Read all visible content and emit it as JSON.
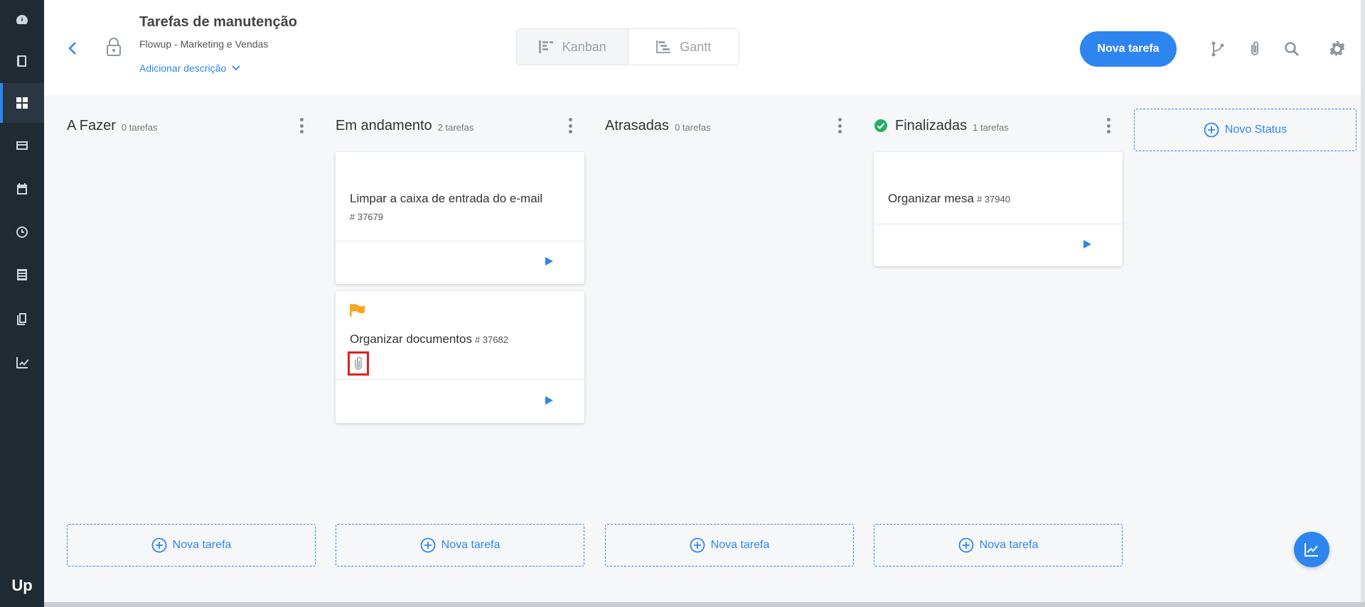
{
  "header": {
    "title": "Tarefas de manutenção",
    "subtitle": "Flowup - Marketing e Vendas",
    "add_description": "Adicionar descrição",
    "views": [
      {
        "label": "Kanban",
        "active": true
      },
      {
        "label": "Gantt",
        "active": false
      }
    ],
    "new_task_label": "Nova tarefa"
  },
  "board": {
    "columns": [
      {
        "title": "A Fazer",
        "count": "0 tarefas",
        "add_label": "Nova tarefa"
      },
      {
        "title": "Em andamento",
        "count": "2 tarefas",
        "add_label": "Nova tarefa"
      },
      {
        "title": "Atrasadas",
        "count": "0 tarefas",
        "add_label": "Nova tarefa"
      },
      {
        "title": "Finalizadas",
        "count": "1 tarefas",
        "add_label": "Nova tarefa"
      }
    ],
    "new_status_label": "Novo Status",
    "cards": {
      "card1": {
        "title": "Limpar a caixa de entrada do e-mail",
        "id": "# 37679"
      },
      "card2": {
        "title": "Organizar documentos",
        "id": "# 37682"
      },
      "card3": {
        "title": "Organizar mesa",
        "id": "# 37940"
      }
    }
  },
  "colors": {
    "accent": "#2d86f0",
    "sidebar": "#1f2a33",
    "flag": "#f5a623",
    "done": "#27ae60",
    "highlight": "#e02020"
  },
  "icons": [
    "dashboard-icon",
    "book-icon",
    "grid-icon",
    "list-icon",
    "calendar-icon",
    "clock-icon",
    "document-icon",
    "pages-icon",
    "chart-icon",
    "lock-icon",
    "branch-icon",
    "paperclip-icon",
    "search-icon",
    "gear-icon",
    "flag-icon",
    "play-icon",
    "check-circle-icon",
    "plus-circle-icon"
  ]
}
